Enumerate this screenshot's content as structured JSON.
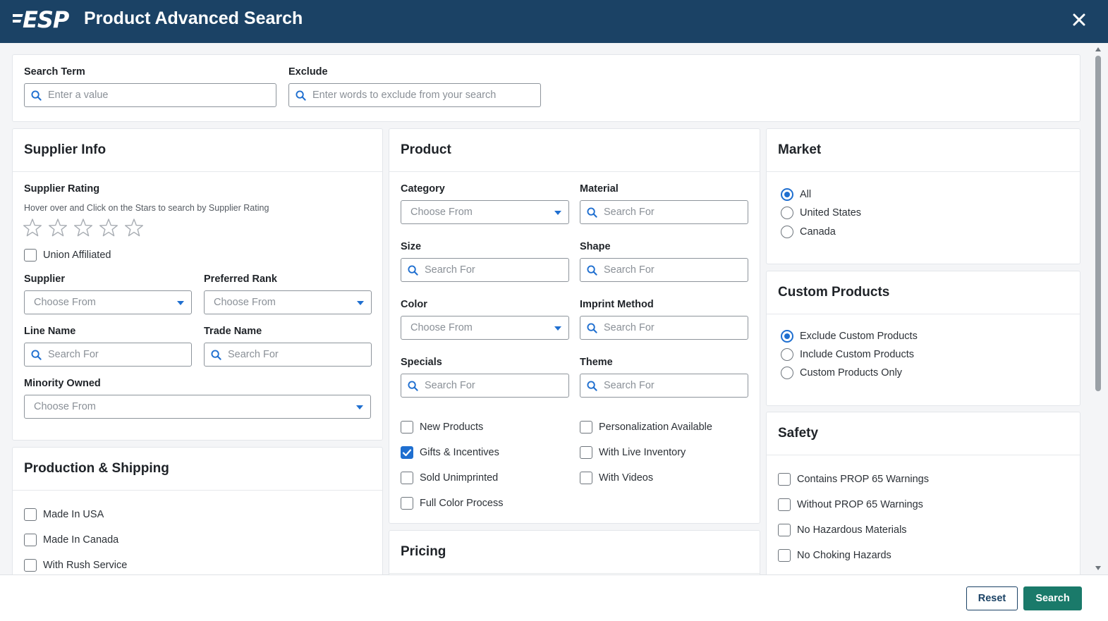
{
  "header": {
    "logo_text": "ESP",
    "title": "Product Advanced Search"
  },
  "search": {
    "term_label": "Search Term",
    "term_placeholder": "Enter a value",
    "exclude_label": "Exclude",
    "exclude_placeholder": "Enter words to exclude from your search"
  },
  "supplier_info": {
    "title": "Supplier Info",
    "rating_label": "Supplier Rating",
    "rating_hint": "Hover over and Click on the Stars to search by Supplier Rating",
    "rating_value": 0,
    "rating_max": 5,
    "union_label": "Union Affiliated",
    "supplier_label": "Supplier",
    "supplier_placeholder": "Choose From",
    "preferred_rank_label": "Preferred Rank",
    "preferred_rank_placeholder": "Choose From",
    "line_name_label": "Line Name",
    "line_name_placeholder": "Search For",
    "trade_name_label": "Trade Name",
    "trade_name_placeholder": "Search For",
    "minority_owned_label": "Minority Owned",
    "minority_owned_placeholder": "Choose From"
  },
  "production_shipping": {
    "title": "Production & Shipping",
    "items": [
      {
        "label": "Made In USA",
        "checked": false
      },
      {
        "label": "Made In Canada",
        "checked": false
      },
      {
        "label": "With Rush Service",
        "checked": false
      }
    ]
  },
  "product": {
    "title": "Product",
    "category_label": "Category",
    "category_placeholder": "Choose From",
    "material_label": "Material",
    "material_placeholder": "Search For",
    "size_label": "Size",
    "size_placeholder": "Search For",
    "shape_label": "Shape",
    "shape_placeholder": "Search For",
    "color_label": "Color",
    "color_placeholder": "Choose From",
    "imprint_label": "Imprint Method",
    "imprint_placeholder": "Search For",
    "specials_label": "Specials",
    "specials_placeholder": "Search For",
    "theme_label": "Theme",
    "theme_placeholder": "Search For",
    "checkboxes_left": [
      {
        "label": "New Products",
        "checked": false
      },
      {
        "label": "Gifts & Incentives",
        "checked": true
      },
      {
        "label": "Sold Unimprinted",
        "checked": false
      },
      {
        "label": "Full Color Process",
        "checked": false
      }
    ],
    "checkboxes_right": [
      {
        "label": "Personalization Available",
        "checked": false
      },
      {
        "label": "With Live Inventory",
        "checked": false
      },
      {
        "label": "With Videos",
        "checked": false
      }
    ]
  },
  "pricing": {
    "title": "Pricing"
  },
  "market": {
    "title": "Market",
    "options": [
      {
        "label": "All",
        "selected": true
      },
      {
        "label": "United States",
        "selected": false
      },
      {
        "label": "Canada",
        "selected": false
      }
    ]
  },
  "custom_products": {
    "title": "Custom Products",
    "options": [
      {
        "label": "Exclude Custom Products",
        "selected": true
      },
      {
        "label": "Include Custom Products",
        "selected": false
      },
      {
        "label": "Custom Products Only",
        "selected": false
      }
    ]
  },
  "safety": {
    "title": "Safety",
    "items": [
      {
        "label": "Contains PROP 65 Warnings",
        "checked": false
      },
      {
        "label": "Without PROP 65 Warnings",
        "checked": false
      },
      {
        "label": "No Hazardous Materials",
        "checked": false
      },
      {
        "label": "No Choking Hazards",
        "checked": false
      }
    ]
  },
  "footer": {
    "reset_label": "Reset",
    "search_label": "Search"
  },
  "colors": {
    "header_bg": "#1b4265",
    "accent": "#1f6fd0",
    "search_button": "#1a7a6a"
  },
  "icons": {
    "close": "close-icon",
    "search": "search-icon",
    "dropdown": "chevron-down-icon",
    "star": "star-icon"
  }
}
